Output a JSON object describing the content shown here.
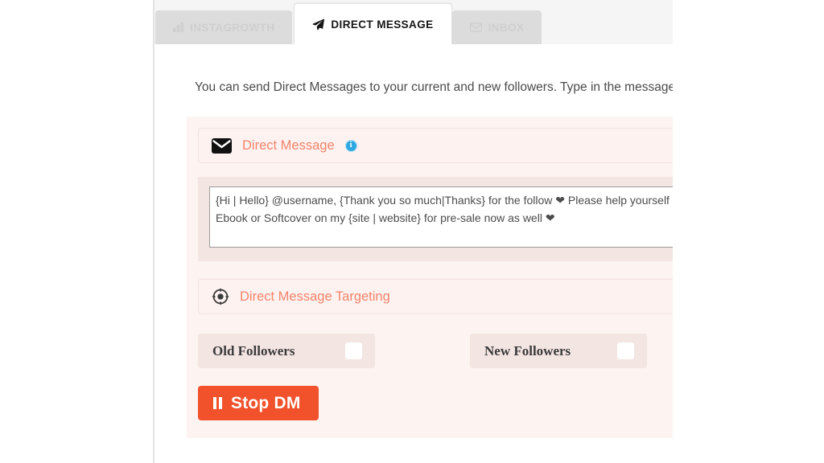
{
  "window": {
    "background": "#ffffff",
    "page_background": "#ffffff"
  },
  "colors": {
    "accent_salmon": "#f4846b",
    "button_orange": "#f1512b",
    "card_pink": "#fdf3f1",
    "band_pink": "#f3e5e2",
    "tab_inactive_bg": "#dcdcdc",
    "tab_inactive_text": "#cfcfcf",
    "info_blue": "#2ea8e0",
    "heart_red": "#e8252a"
  },
  "tabs": [
    {
      "id": "instagrowth",
      "label": "INSTAGROWTH",
      "icon": "bar-chart-icon",
      "active": false
    },
    {
      "id": "direct-message",
      "label": "DIRECT MESSAGE",
      "icon": "paper-plane-icon",
      "active": true
    },
    {
      "id": "inbox",
      "label": "INBOX",
      "icon": "envelope-open-icon",
      "active": false
    }
  ],
  "main": {
    "intro": "You can send Direct Messages to your current and new followers. Type in the message below and select your targeting options.",
    "direct_message": {
      "icon": "envelope-icon",
      "title": "Direct Message",
      "info_icon": "info-circle-icon",
      "info_glyph": "i",
      "message_line_1": "{Hi | Hello} @username, {Thank you so much|Thanks} for the follow ❤ Please help yourself to an",
      "message_line_2": "Ebook or Softcover on my {site | website} for pre-sale now as well ❤"
    },
    "targeting": {
      "icon": "crosshair-target-icon",
      "title": "Direct Message Targeting",
      "options": [
        {
          "id": "old-followers",
          "label": "Old Followers",
          "checked": false
        },
        {
          "id": "new-followers",
          "label": "New Followers",
          "checked": false
        }
      ]
    },
    "action_button": {
      "label": "Stop DM",
      "icon": "pause-icon"
    }
  }
}
